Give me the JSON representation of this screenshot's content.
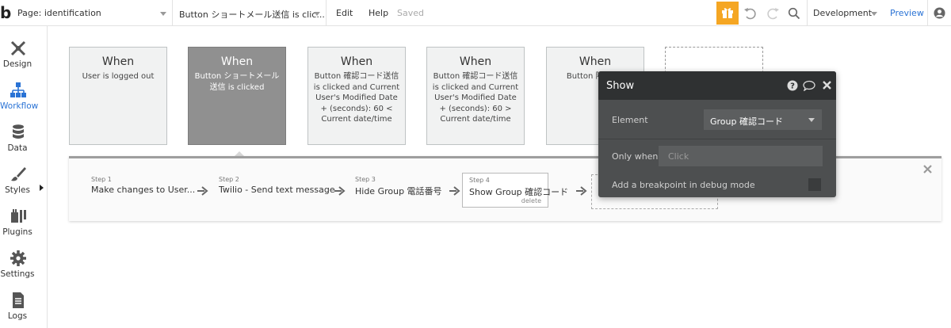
{
  "topbar": {
    "logo": "b",
    "page_select": "Page: identification",
    "workflow_select": "Button ショートメール送信 is clic...",
    "menu_edit": "Edit",
    "menu_help": "Help",
    "saved": "Saved",
    "environment": "Development",
    "preview": "Preview"
  },
  "sidebar": {
    "items": [
      {
        "label": "Design",
        "icon": "design-icon"
      },
      {
        "label": "Workflow",
        "icon": "workflow-icon"
      },
      {
        "label": "Data",
        "icon": "data-icon"
      },
      {
        "label": "Styles",
        "icon": "styles-icon"
      },
      {
        "label": "Plugins",
        "icon": "plugins-icon"
      },
      {
        "label": "Settings",
        "icon": "settings-icon"
      },
      {
        "label": "Logs",
        "icon": "logs-icon"
      }
    ],
    "active": "Workflow"
  },
  "events": [
    {
      "when": "When",
      "desc": "User is logged out"
    },
    {
      "when": "When",
      "desc": "Button ショートメール送信 is clicked"
    },
    {
      "when": "When",
      "desc": "Button 確認コード送信 is clicked and Current User's Modified Date + (seconds): 60 < Current date/time"
    },
    {
      "when": "When",
      "desc": "Button 確認コード送信 is clicked and Current User's Modified Date + (seconds): 60 > Current date/time"
    },
    {
      "when": "When",
      "desc": "Button 隣 click"
    }
  ],
  "steps": [
    {
      "num": "Step 1",
      "label": "Make changes to User..."
    },
    {
      "num": "Step 2",
      "label": "Twilio - Send text message"
    },
    {
      "num": "Step 3",
      "label": "Hide Group 電話番号"
    },
    {
      "num": "Step 4",
      "label": "Show Group 確認コード",
      "delete": "delete"
    }
  ],
  "popup": {
    "title": "Show",
    "element_label": "Element",
    "element_value": "Group 確認コード",
    "only_when_label": "Only when",
    "only_when_placeholder": "Click",
    "breakpoint_label": "Add a breakpoint in debug mode"
  },
  "colors": {
    "accent": "#2a73d5",
    "gift": "#f5a623",
    "popup_bg": "#4d4f50",
    "popup_header": "#2f3132",
    "selected_card": "#909090"
  }
}
